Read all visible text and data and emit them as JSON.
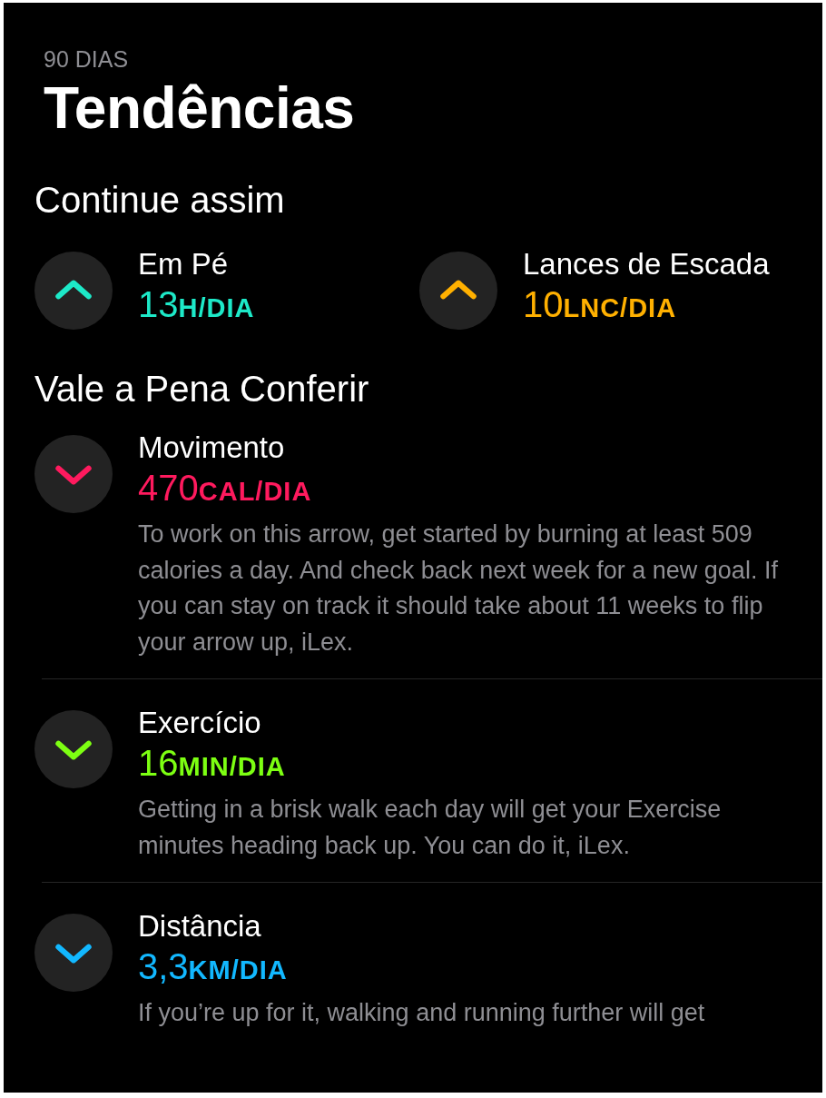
{
  "header": {
    "period": "90 DIAS",
    "title": "Tendências"
  },
  "sections": [
    {
      "title": "Continue assim",
      "kind": "grid",
      "items": [
        {
          "kind": "up",
          "color": "#1de9c8",
          "name": "Em Pé",
          "value": "13",
          "unit": "H/DIA"
        },
        {
          "kind": "up",
          "color": "#ffb000",
          "name": "Lances de Escada",
          "value": "10",
          "unit": "LNC/DIA"
        }
      ]
    },
    {
      "title": "Vale a Pena Conferir",
      "kind": "list",
      "items": [
        {
          "kind": "down",
          "color": "#ff1a5e",
          "name": "Movimento",
          "value": "470",
          "unit": "CAL/DIA",
          "description": "To work on this arrow, get started by burning at least 509 calories a day. And check back next week for a new goal. If you can stay on track it should take about 11 weeks to flip your arrow up, iLex."
        },
        {
          "kind": "down",
          "color": "#7dff12",
          "name": "Exercício",
          "value": "16",
          "unit": "MIN/DIA",
          "description": "Getting in a brisk walk each day will get your Exercise minutes heading back up. You can do it, iLex."
        },
        {
          "kind": "down",
          "color": "#12b8ff",
          "name": "Distância",
          "value": "3,3",
          "unit": "KM/DIA",
          "description": "If you’re up for it, walking and running further will get"
        }
      ]
    }
  ]
}
